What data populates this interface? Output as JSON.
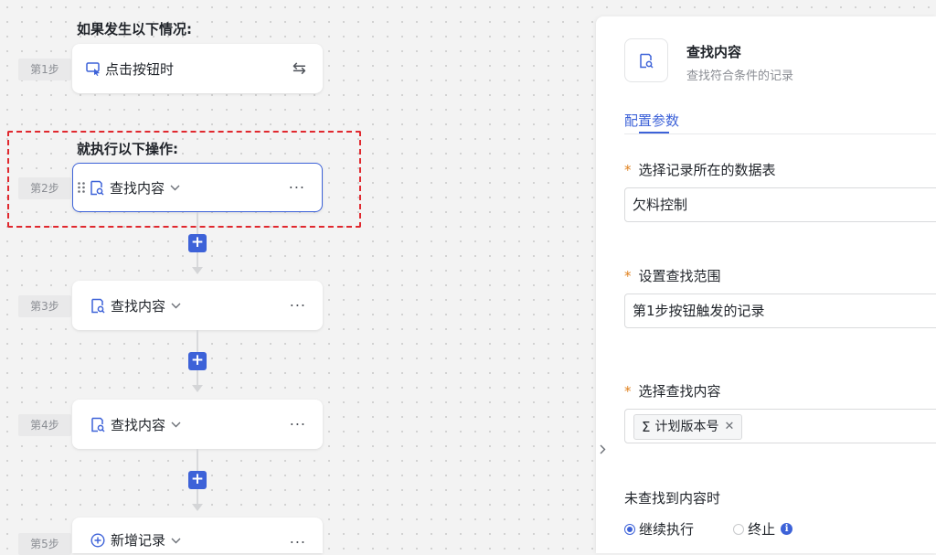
{
  "flow": {
    "trigger_heading": "如果发生以下情况:",
    "action_heading": "就执行以下操作:",
    "steps": [
      {
        "tag": "第1步",
        "label": "点击按钮时",
        "icon": "click-cursor-icon"
      },
      {
        "tag": "第2步",
        "label": "查找内容",
        "icon": "find-record-icon"
      },
      {
        "tag": "第3步",
        "label": "查找内容",
        "icon": "find-record-icon"
      },
      {
        "tag": "第4步",
        "label": "查找内容",
        "icon": "find-record-icon"
      },
      {
        "tag": "第5步",
        "label": "新增记录",
        "icon": "add-circle-icon"
      }
    ],
    "more_glyph": "···",
    "plus_glyph": "+",
    "swap_glyph": "⇆"
  },
  "panel": {
    "title": "查找内容",
    "subtitle": "查找符合条件的记录",
    "tab": "配置参数",
    "fields": {
      "table_label": "选择记录所在的数据表",
      "table_value": "欠料控制",
      "scope_label": "设置查找范围",
      "scope_value": "第1步按钮触发的记录",
      "content_label": "选择查找内容",
      "content_tag": "计划版本号",
      "not_found_label": "未查找到内容时",
      "options": [
        "继续执行",
        "终止"
      ],
      "selected_option": "继续执行"
    },
    "required_mark": "*"
  },
  "colors": {
    "accent": "#3d62d8",
    "dashed_highlight": "#e0282e",
    "required_star": "#e0821f"
  }
}
